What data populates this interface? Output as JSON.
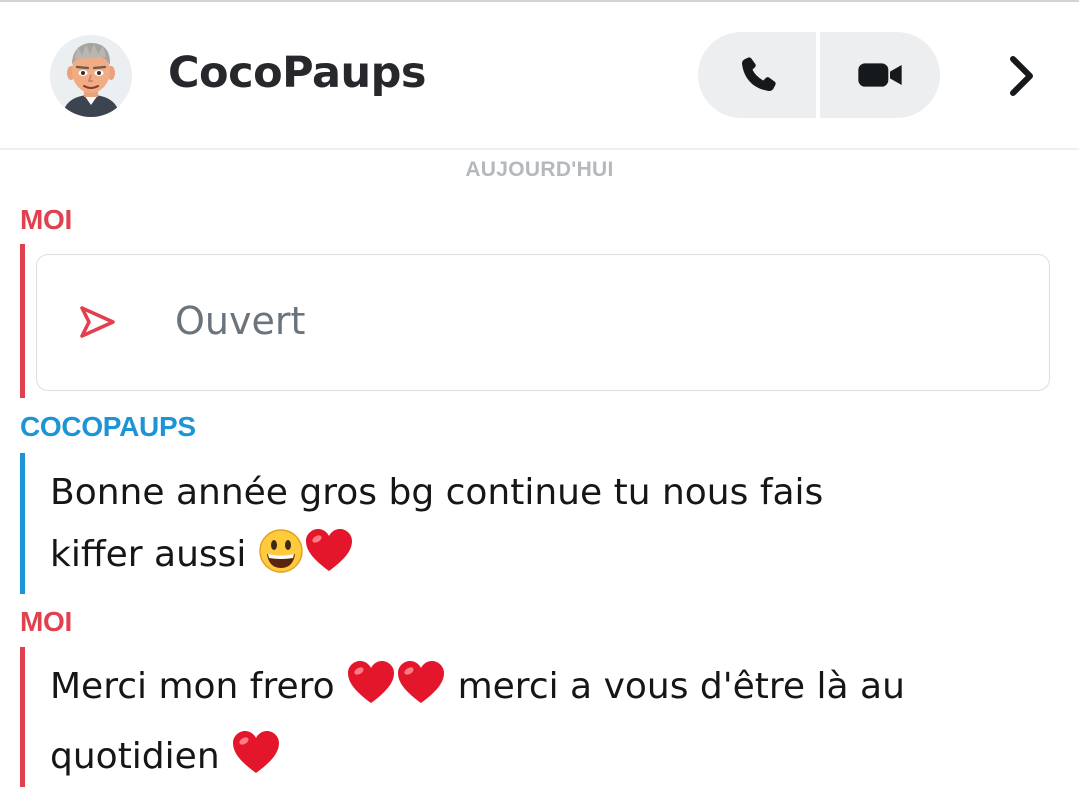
{
  "header": {
    "contact_name": "CocoPaups",
    "icons": {
      "avatar": "bitmoji-avatar",
      "phone": "phone-icon",
      "video": "video-camera-icon",
      "chevron": "chevron-right-icon"
    }
  },
  "date_separator": "AUJOURD'HUI",
  "messages": [
    {
      "sender": "MOI",
      "type": "snap",
      "status": "Ouvert",
      "status_icon": "sent-arrow-outline-icon"
    },
    {
      "sender": "COCOPAUPS",
      "type": "text",
      "line1": "Bonne année gros bg continue tu nous fais",
      "line2": "kiffer aussi",
      "line2_emojis": [
        "grinning-face-emoji",
        "heart-emoji"
      ]
    },
    {
      "sender": "MOI",
      "type": "text",
      "line1_part1": "Merci mon frero",
      "line1_emojis": [
        "heart-emoji",
        "heart-emoji"
      ],
      "line1_part2": "merci a vous d'être là au",
      "line2": "quotidien",
      "line2_emojis": [
        "heart-emoji"
      ]
    }
  ],
  "colors": {
    "me": "#e1404f",
    "friend": "#1c94d6",
    "date_label": "#b5b9be",
    "call_group_bg": "#eceef0"
  }
}
